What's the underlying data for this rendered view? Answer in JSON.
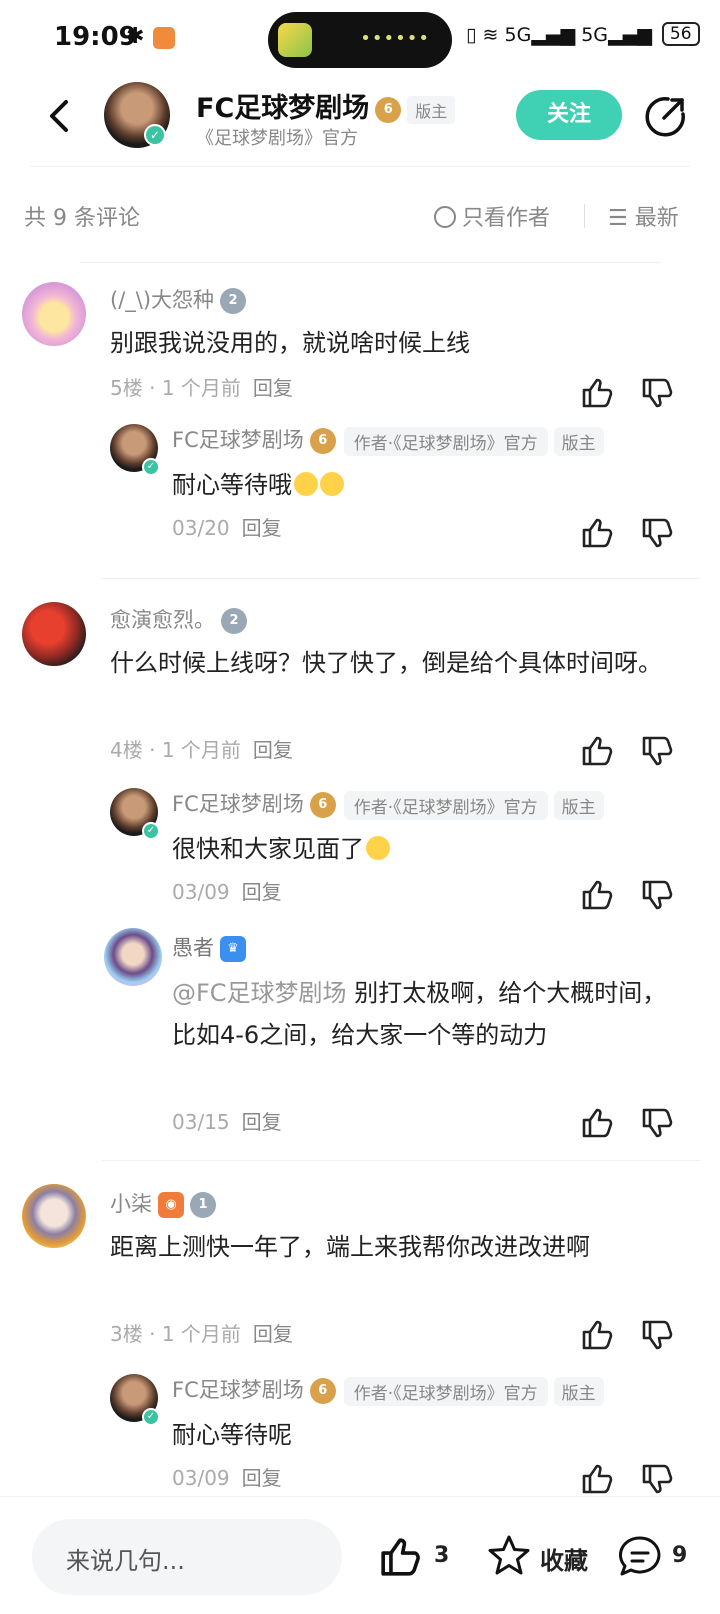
{
  "status_bar": {
    "time": "19:09",
    "network_1": "5G",
    "network_2": "5G",
    "battery": "56"
  },
  "header": {
    "title": "FC足球梦剧场",
    "level": "6",
    "mod_tag": "版主",
    "subtitle": "《足球梦剧场》官方",
    "follow_label": "关注"
  },
  "filter": {
    "count_label": "共 9 条评论",
    "author_only_label": "只看作者",
    "sort_label": "最新"
  },
  "comments": [
    {
      "user": "(/_\\)大怨种",
      "level": "2",
      "text": "别跟我说没用的，就说啥时候上线",
      "floor": "5楼",
      "time": "1 个月前",
      "reply_label": "回复",
      "replies": [
        {
          "user": "FC足球梦剧场",
          "level": "6",
          "author_tag": "作者·《足球梦剧场》官方",
          "mod_tag": "版主",
          "text": "耐心等待哦",
          "date": "03/20",
          "reply_label": "回复"
        }
      ]
    },
    {
      "user": "愈演愈烈。",
      "level": "2",
      "text": "什么时候上线呀？快了快了，倒是给个具体时间呀。",
      "floor": "4楼",
      "time": "1 个月前",
      "reply_label": "回复",
      "replies": [
        {
          "user": "FC足球梦剧场",
          "level": "6",
          "author_tag": "作者·《足球梦剧场》官方",
          "mod_tag": "版主",
          "text": "很快和大家见面了",
          "date": "03/09",
          "reply_label": "回复"
        },
        {
          "user": "愚者",
          "mention": "@FC足球梦剧场",
          "text": " 别打太极啊，给个大概时间，比如4-6之间，给大家一个等的动力",
          "date": "03/15",
          "reply_label": "回复"
        }
      ]
    },
    {
      "user": "小柒",
      "level": "1",
      "text": "距离上测快一年了，端上来我帮你改进改进啊",
      "floor": "3楼",
      "time": "1 个月前",
      "reply_label": "回复",
      "replies": [
        {
          "user": "FC足球梦剧场",
          "level": "6",
          "author_tag": "作者·《足球梦剧场》官方",
          "mod_tag": "版主",
          "text": "耐心等待呢",
          "date": "03/09",
          "reply_label": "回复"
        }
      ]
    }
  ],
  "bottom_bar": {
    "input_placeholder": "来说几句...",
    "like_count": "3",
    "favorite_label": "收藏",
    "comment_count": "9"
  },
  "colors": {
    "accent": "#40d1b5",
    "level_gold": "#d9a24a",
    "level_gray": "#9aa7b4"
  }
}
